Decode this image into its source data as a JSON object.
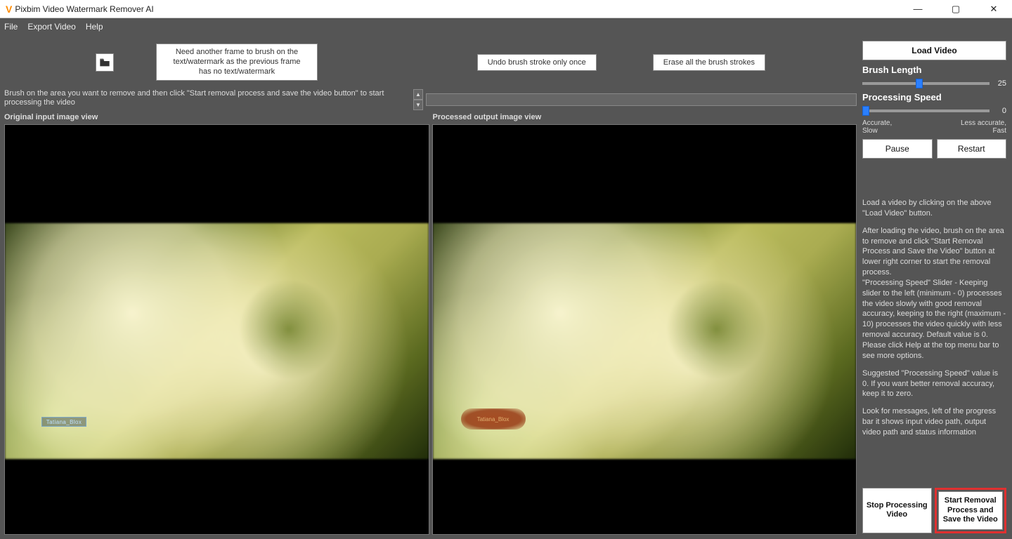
{
  "window": {
    "title": "Pixbim Video Watermark Remover AI"
  },
  "menu": {
    "file": "File",
    "export": "Export Video",
    "help": "Help"
  },
  "toolbar": {
    "need_frame": "Need another frame to brush on the text/watermark as the previous frame has no text/watermark",
    "undo": "Undo brush stroke only once",
    "erase": "Erase all the brush strokes"
  },
  "message": "Brush on the area you want to remove and then click \"Start removal process and save the video button\" to start processing the video",
  "views": {
    "original_label": "Original input image view",
    "processed_label": "Processed output image view",
    "watermark_left": "Tatiana_Blox",
    "watermark_right": "Tatiana_Blox"
  },
  "sidebar": {
    "load_video": "Load Video",
    "brush_length": "Brush Length",
    "brush_value": "25",
    "processing_speed": "Processing Speed",
    "speed_value": "0",
    "accurate": "Accurate,",
    "slow": "Slow",
    "less_accurate": "Less accurate,",
    "fast": "Fast",
    "pause": "Pause",
    "restart": "Restart",
    "p1": "Load a video by clicking on the above \"Load Video\" button.",
    "p2": "After loading the video, brush on the area to remove and click \"Start Removal Process and Save the Video\" button at lower right corner to start the removal process.",
    "p3": "\"Processing Speed\" Slider - Keeping slider to the left (minimum - 0) processes the video slowly with good removal accuracy, keeping to the right (maximum - 10) processes the video quickly with less removal accuracy. Default value is 0. Please click Help at the top menu bar to see more options.",
    "p4": "Suggested \"Processing Speed\" value is 0. If you want better removal accuracy, keep it to zero.",
    "p5": "Look for messages, left of the progress bar it shows input video path, output video path and status information",
    "stop": "Stop Processing Video",
    "start": "Start Removal Process and Save the Video"
  }
}
